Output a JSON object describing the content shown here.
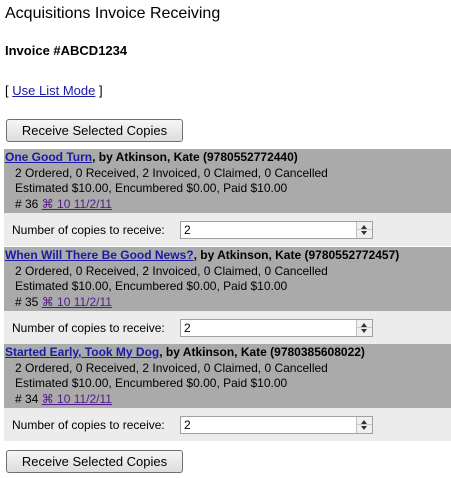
{
  "page": {
    "title": "Acquisitions Invoice Receiving",
    "invoice_label": "Invoice #ABCD1234",
    "mode_link": {
      "open_bracket": "[",
      "label": "Use List Mode",
      "close_bracket": "]"
    },
    "receive_button_label": "Receive Selected Copies"
  },
  "items": [
    {
      "title": "One Good Turn",
      "author_isbn": ", by Atkinson, Kate (9780552772440)",
      "counts": "2 Ordered, 0 Received, 2 Invoiced, 0 Claimed, 0 Cancelled",
      "money": "Estimated $10.00, Encumbered $0.00, Paid $10.00",
      "number": "# 36",
      "po_link": "⌘ 10 11/2/11",
      "copies_label": "Number of copies to receive:",
      "copies_value": "2"
    },
    {
      "title": "When Will There Be Good News?",
      "author_isbn": ", by Atkinson, Kate (9780552772457)",
      "counts": "2 Ordered, 0 Received, 2 Invoiced, 0 Claimed, 0 Cancelled",
      "money": "Estimated $10.00, Encumbered $0.00, Paid $10.00",
      "number": "# 35",
      "po_link": "⌘ 10 11/2/11",
      "copies_label": "Number of copies to receive:",
      "copies_value": "2"
    },
    {
      "title": "Started Early, Took My Dog",
      "author_isbn": ", by Atkinson, Kate (9780385608022)",
      "counts": "2 Ordered, 0 Received, 2 Invoiced, 0 Claimed, 0 Cancelled",
      "money": "Estimated $10.00, Encumbered $0.00, Paid $10.00",
      "number": "# 34",
      "po_link": "⌘ 10 11/2/11",
      "copies_label": "Number of copies to receive:",
      "copies_value": "2"
    }
  ],
  "colors": {
    "item_header_bg": "#aaaaaa",
    "copies_row_bg": "#ececec",
    "link": "#1a1aa6",
    "visited_link": "#551a8b"
  },
  "icons": {
    "spinner_up": "spinner-up-icon",
    "spinner_down": "spinner-down-icon"
  }
}
